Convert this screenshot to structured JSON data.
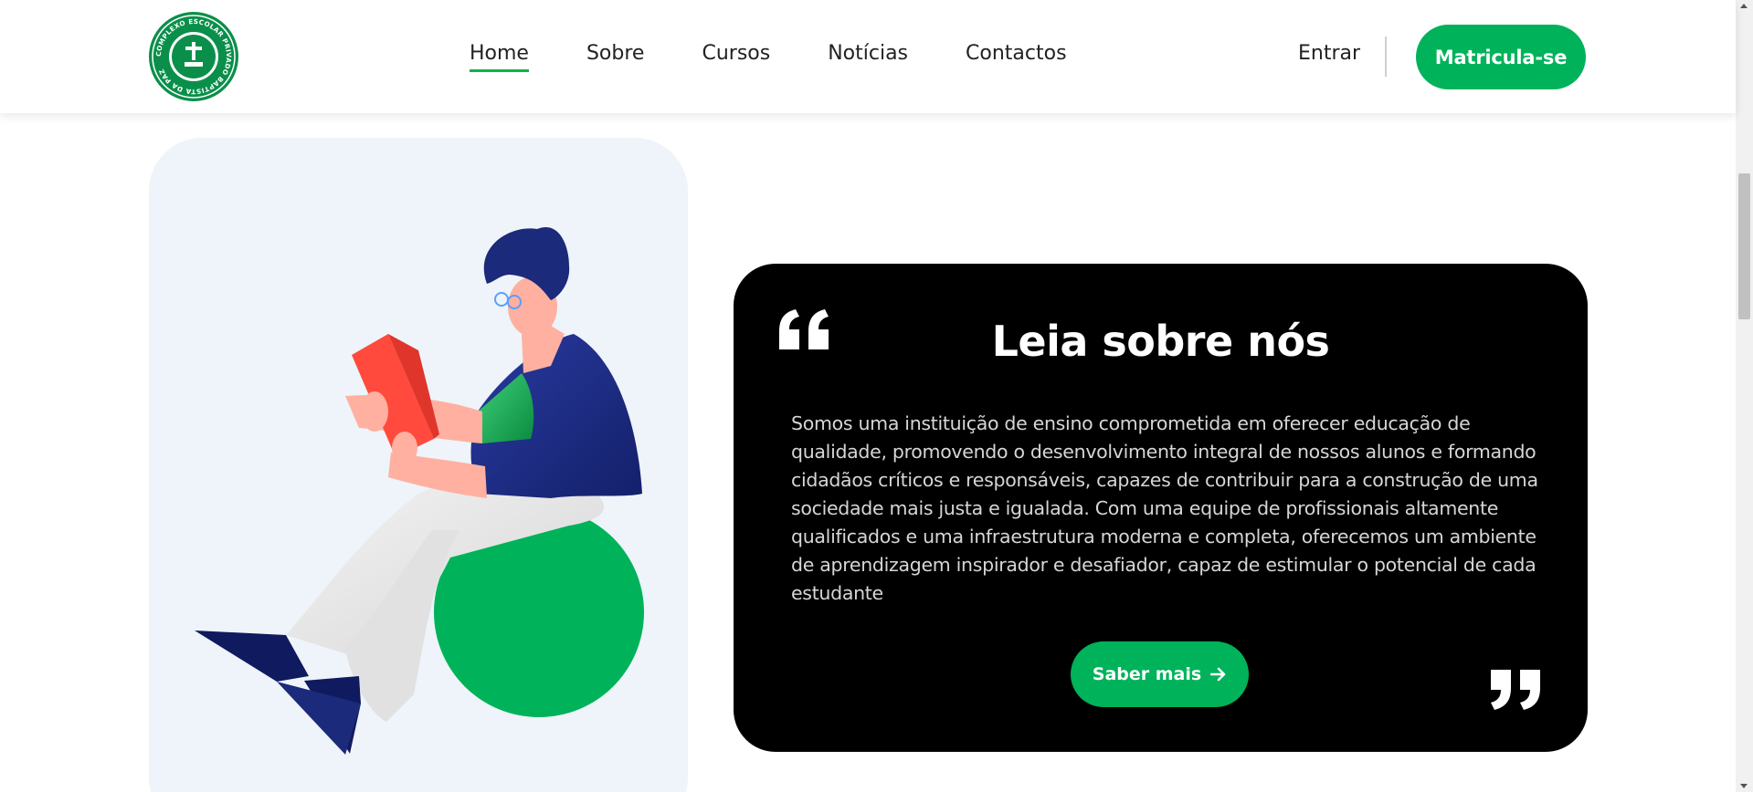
{
  "header": {
    "logo_text": "COMPLEXO ESCOLAR PRIVADO BAPTISTA DA PAZ",
    "nav": [
      {
        "label": "Home",
        "active": true
      },
      {
        "label": "Sobre",
        "active": false
      },
      {
        "label": "Cursos",
        "active": false
      },
      {
        "label": "Notícias",
        "active": false
      },
      {
        "label": "Contactos",
        "active": false
      }
    ],
    "login_label": "Entrar",
    "enroll_label": "Matricula-se"
  },
  "about": {
    "title": "Leia sobre nós",
    "text": "Somos uma instituição de ensino comprometida em oferecer educação de qualidade, promovendo o desenvolvimento integral de nossos alunos e formando cidadãos críticos e responsáveis, capazes de contribuir para a construção de uma sociedade mais justa e igualada. Com uma equipe de profissionais altamente qualificados e uma infraestrutura moderna e completa, oferecemos um ambiente de aprendizagem inspirador e desafiador, capaz de estimular o potencial de cada estudante",
    "button_label": "Saber mais",
    "button_icon": "arrow-right-icon"
  },
  "colors": {
    "brand_green": "#00b25a",
    "card_bg": "#000000",
    "panel_bg": "#eef4f9",
    "figure_navy": "#1b2a7a",
    "book_red": "#ff4a3d"
  }
}
